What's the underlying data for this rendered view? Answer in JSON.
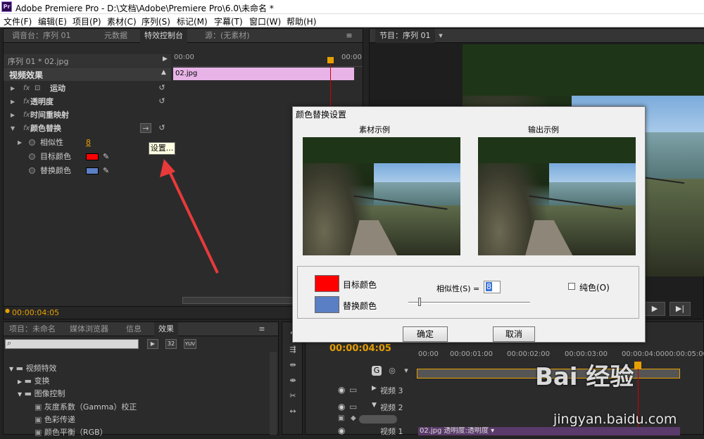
{
  "window": {
    "app_logo": "Pr",
    "title": "Adobe Premiere Pro - D:\\文档\\Adobe\\Premiere Pro\\6.0\\未命名 *"
  },
  "menu": [
    "文件(F)",
    "编辑(E)",
    "项目(P)",
    "素材(C)",
    "序列(S)",
    "标记(M)",
    "字幕(T)",
    "窗口(W)",
    "帮助(H)"
  ],
  "left_panel": {
    "tabs": [
      "调音台：序列 01",
      "元数据",
      "特效控制台",
      "源：(无素材)"
    ],
    "sequence_label": "序列 01 * 02.jpg",
    "timeline_time": "00:00",
    "clip_label": "02.jpg",
    "section_title": "视频效果",
    "effects": [
      {
        "label": "运动",
        "type": "fx"
      },
      {
        "label": "透明度",
        "type": "fx"
      },
      {
        "label": "时间重映射",
        "type": "fx"
      },
      {
        "label": "颜色替换",
        "type": "fx"
      },
      {
        "label": "相似性",
        "value": "8"
      },
      {
        "label": "目标颜色"
      },
      {
        "label": "替换颜色"
      }
    ],
    "tooltip": "设置...",
    "current_time": "00:00:04:05"
  },
  "program_panel": {
    "tab": "节目：序列 01"
  },
  "project_panel": {
    "tabs": [
      "项目：未命名",
      "媒体浏览器",
      "信息",
      "效果"
    ],
    "search_placeholder": "",
    "badges": [
      "32",
      "YUV"
    ],
    "tree": [
      "视频特效",
      "变换",
      "图像控制",
      "灰度系数（Gamma）校正",
      "色彩传递",
      "颜色平衡（RGB）"
    ]
  },
  "timeline_panel": {
    "timecode": "00:00:04:05",
    "ruler": [
      "00:00",
      "00:00:01:00",
      "00:00:02:00",
      "00:00:03:00",
      "00:00:04:00",
      "00:00:05:00"
    ],
    "tracks": [
      "视频 3",
      "视频 2",
      "视频 1"
    ],
    "clip": "02.jpg  透明度:透明度 ▾"
  },
  "dialog": {
    "title": "颜色替换设置",
    "source_label": "素材示例",
    "output_label": "输出示例",
    "target_color_label": "目标颜色",
    "replace_color_label": "替换颜色",
    "similarity_label": "相似性(S) =",
    "similarity_value": "8",
    "similarity_fraction": 0.08,
    "solid_color_label": "纯色(O)",
    "solid_color_checked": false,
    "ok": "确定",
    "cancel": "取消"
  },
  "colors": {
    "target": "#ff0000",
    "replace": "#5b7fc4",
    "clip": "#e8b4e8",
    "timeline_clip": "#5a3a6a",
    "accent_time": "#e8a000"
  },
  "watermark": {
    "text": "Bai 经验",
    "url": "jingyan.baidu.com"
  }
}
